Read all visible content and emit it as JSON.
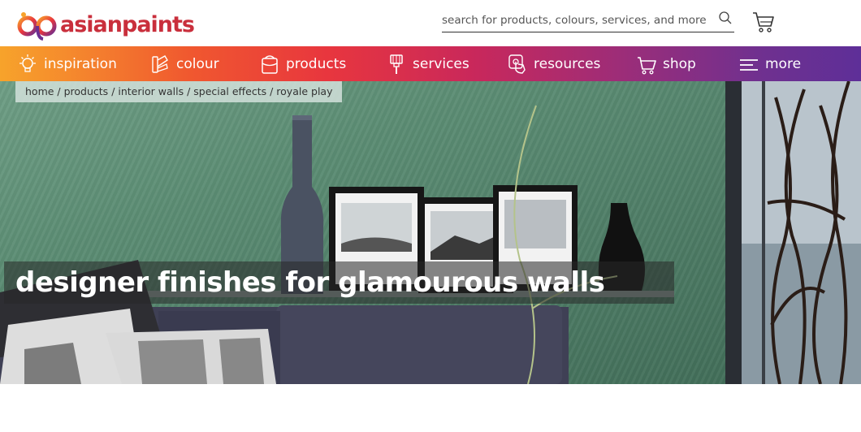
{
  "brand": {
    "name": "asianpaints",
    "color": "#c92f3c"
  },
  "search": {
    "placeholder": "search for products, colours, services, and more",
    "icon": "search-icon"
  },
  "cart": {
    "icon": "cart-icon"
  },
  "nav": {
    "items": [
      {
        "label": "inspiration",
        "icon": "lightbulb-icon"
      },
      {
        "label": "colour",
        "icon": "colour-fan-icon"
      },
      {
        "label": "products",
        "icon": "paint-bucket-icon"
      },
      {
        "label": "services",
        "icon": "paint-brush-icon"
      },
      {
        "label": "resources",
        "icon": "touch-icon"
      },
      {
        "label": "shop",
        "icon": "shopping-cart-icon"
      },
      {
        "label": "more",
        "icon": "menu-icon"
      }
    ]
  },
  "breadcrumb": {
    "items": [
      "home",
      "products",
      "interior walls",
      "special effects",
      "royale play"
    ],
    "separator": " / "
  },
  "hero": {
    "title": "designer finishes for glamourous walls"
  },
  "colors": {
    "wall": "#5c8d74",
    "sofa": "#3f4055",
    "nav_start": "#f7a32b",
    "nav_end": "#5e2f98"
  }
}
